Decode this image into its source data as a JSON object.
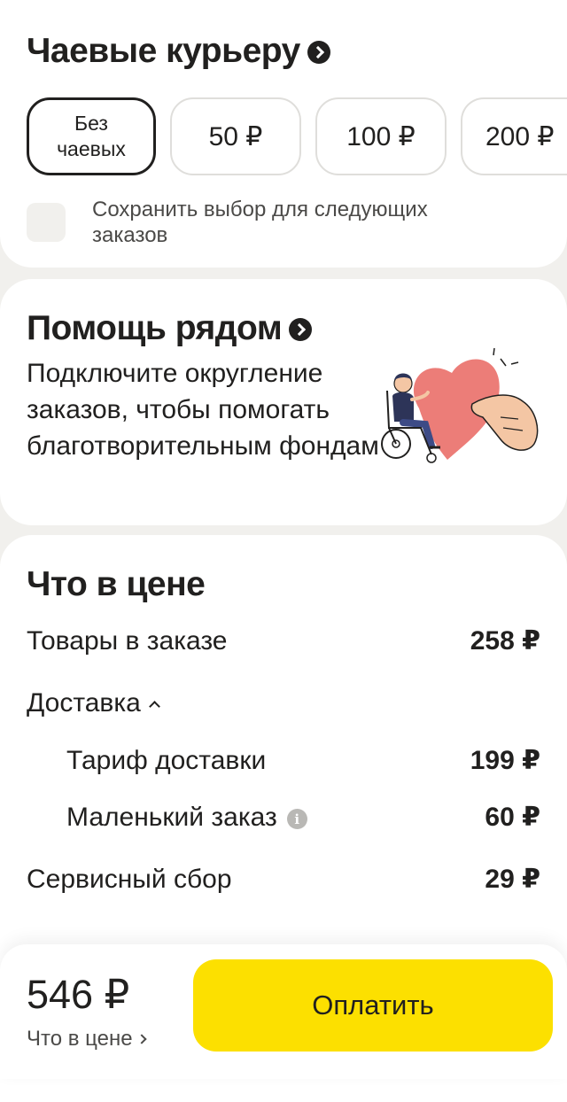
{
  "tips": {
    "title": "Чаевые курьеру",
    "options": [
      {
        "label_line1": "Без",
        "label_line2": "чаевых",
        "selected": true
      },
      {
        "label": "50 ₽",
        "selected": false
      },
      {
        "label": "100 ₽",
        "selected": false
      },
      {
        "label": "200 ₽",
        "selected": false
      }
    ],
    "save_choice": {
      "label": "Сохранить выбор для следующих заказов",
      "checked": false
    }
  },
  "help": {
    "title": "Помощь рядом",
    "description": "Подключите округление заказов, чтобы помогать благотворительным фондам",
    "illustration": "charity-heart-illustration"
  },
  "price": {
    "title": "Что в цене",
    "items": {
      "goods": {
        "label": "Товары в заказе",
        "value": "258 ₽"
      },
      "delivery": {
        "label": "Доставка",
        "expanded": true
      },
      "tariff": {
        "label": "Тариф доставки",
        "value": "199 ₽"
      },
      "small_order": {
        "label": "Маленький заказ",
        "value": "60 ₽",
        "info_glyph": "i"
      },
      "service_fee": {
        "label": "Сервисный сбор",
        "value": "29 ₽"
      }
    }
  },
  "footer": {
    "total": "546 ₽",
    "details_link": "Что в цене",
    "pay_button": "Оплатить"
  },
  "colors": {
    "accent": "#fce000",
    "text": "#21201f",
    "background": "#f1f0ed",
    "heart": "#ec7d78"
  }
}
